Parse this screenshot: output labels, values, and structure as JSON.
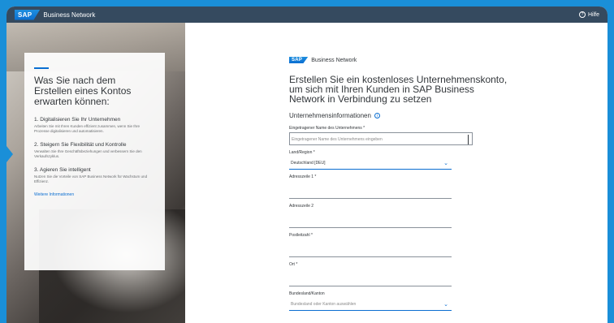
{
  "topbar": {
    "logo": "SAP",
    "brand": "Business Network",
    "help": "Hilfe"
  },
  "card": {
    "title": "Was Sie nach dem Erstellen eines Kontos erwarten können:",
    "items": [
      {
        "title": "1. Digitalisieren Sie Ihr Unternehmen",
        "text": "Arbeiten Sie mit Ihren Kunden effizient zusammen, wenn Sie Ihre Prozesse digitalisieren und automatisieren."
      },
      {
        "title": "2. Steigern Sie Flexibilität und Kontrolle",
        "text": "Verwalten Sie Ihre Geschäftsbeziehungen und verbessern Sie den Verkaufszyklus."
      },
      {
        "title": "3. Agieren Sie intelligent",
        "text": "Nutzen Sie die Vorteile von SAP Business Network für Wachstum und Effizienz."
      }
    ],
    "link": "Weitere Informationen"
  },
  "form": {
    "logo": "SAP",
    "brand": "Business Network",
    "heading": "Erstellen Sie ein kostenloses Unternehmenskonto, um sich mit Ihren Kunden in SAP Business Network in Verbindung zu setzen",
    "section": "Unternehmensinformationen",
    "fields": {
      "company_label": "Eingetragener Name des Unternehmens *",
      "company_placeholder": "Eingetragener Name des Unternehmens eingeben",
      "country_label": "Land/Region *",
      "country_value": "Deutschland [DEU]",
      "address1_label": "Adresszeile 1 *",
      "address2_label": "Adresszeile 2",
      "postal_label": "Postleitzahl *",
      "city_label": "Ort *",
      "state_label": "Bundesland/Kanton",
      "state_placeholder": "Bundesland oder Kanton auswählen"
    }
  },
  "colors": {
    "accent": "#0a6ed1",
    "topbar": "#354a5f",
    "background": "#1a8fd8"
  }
}
